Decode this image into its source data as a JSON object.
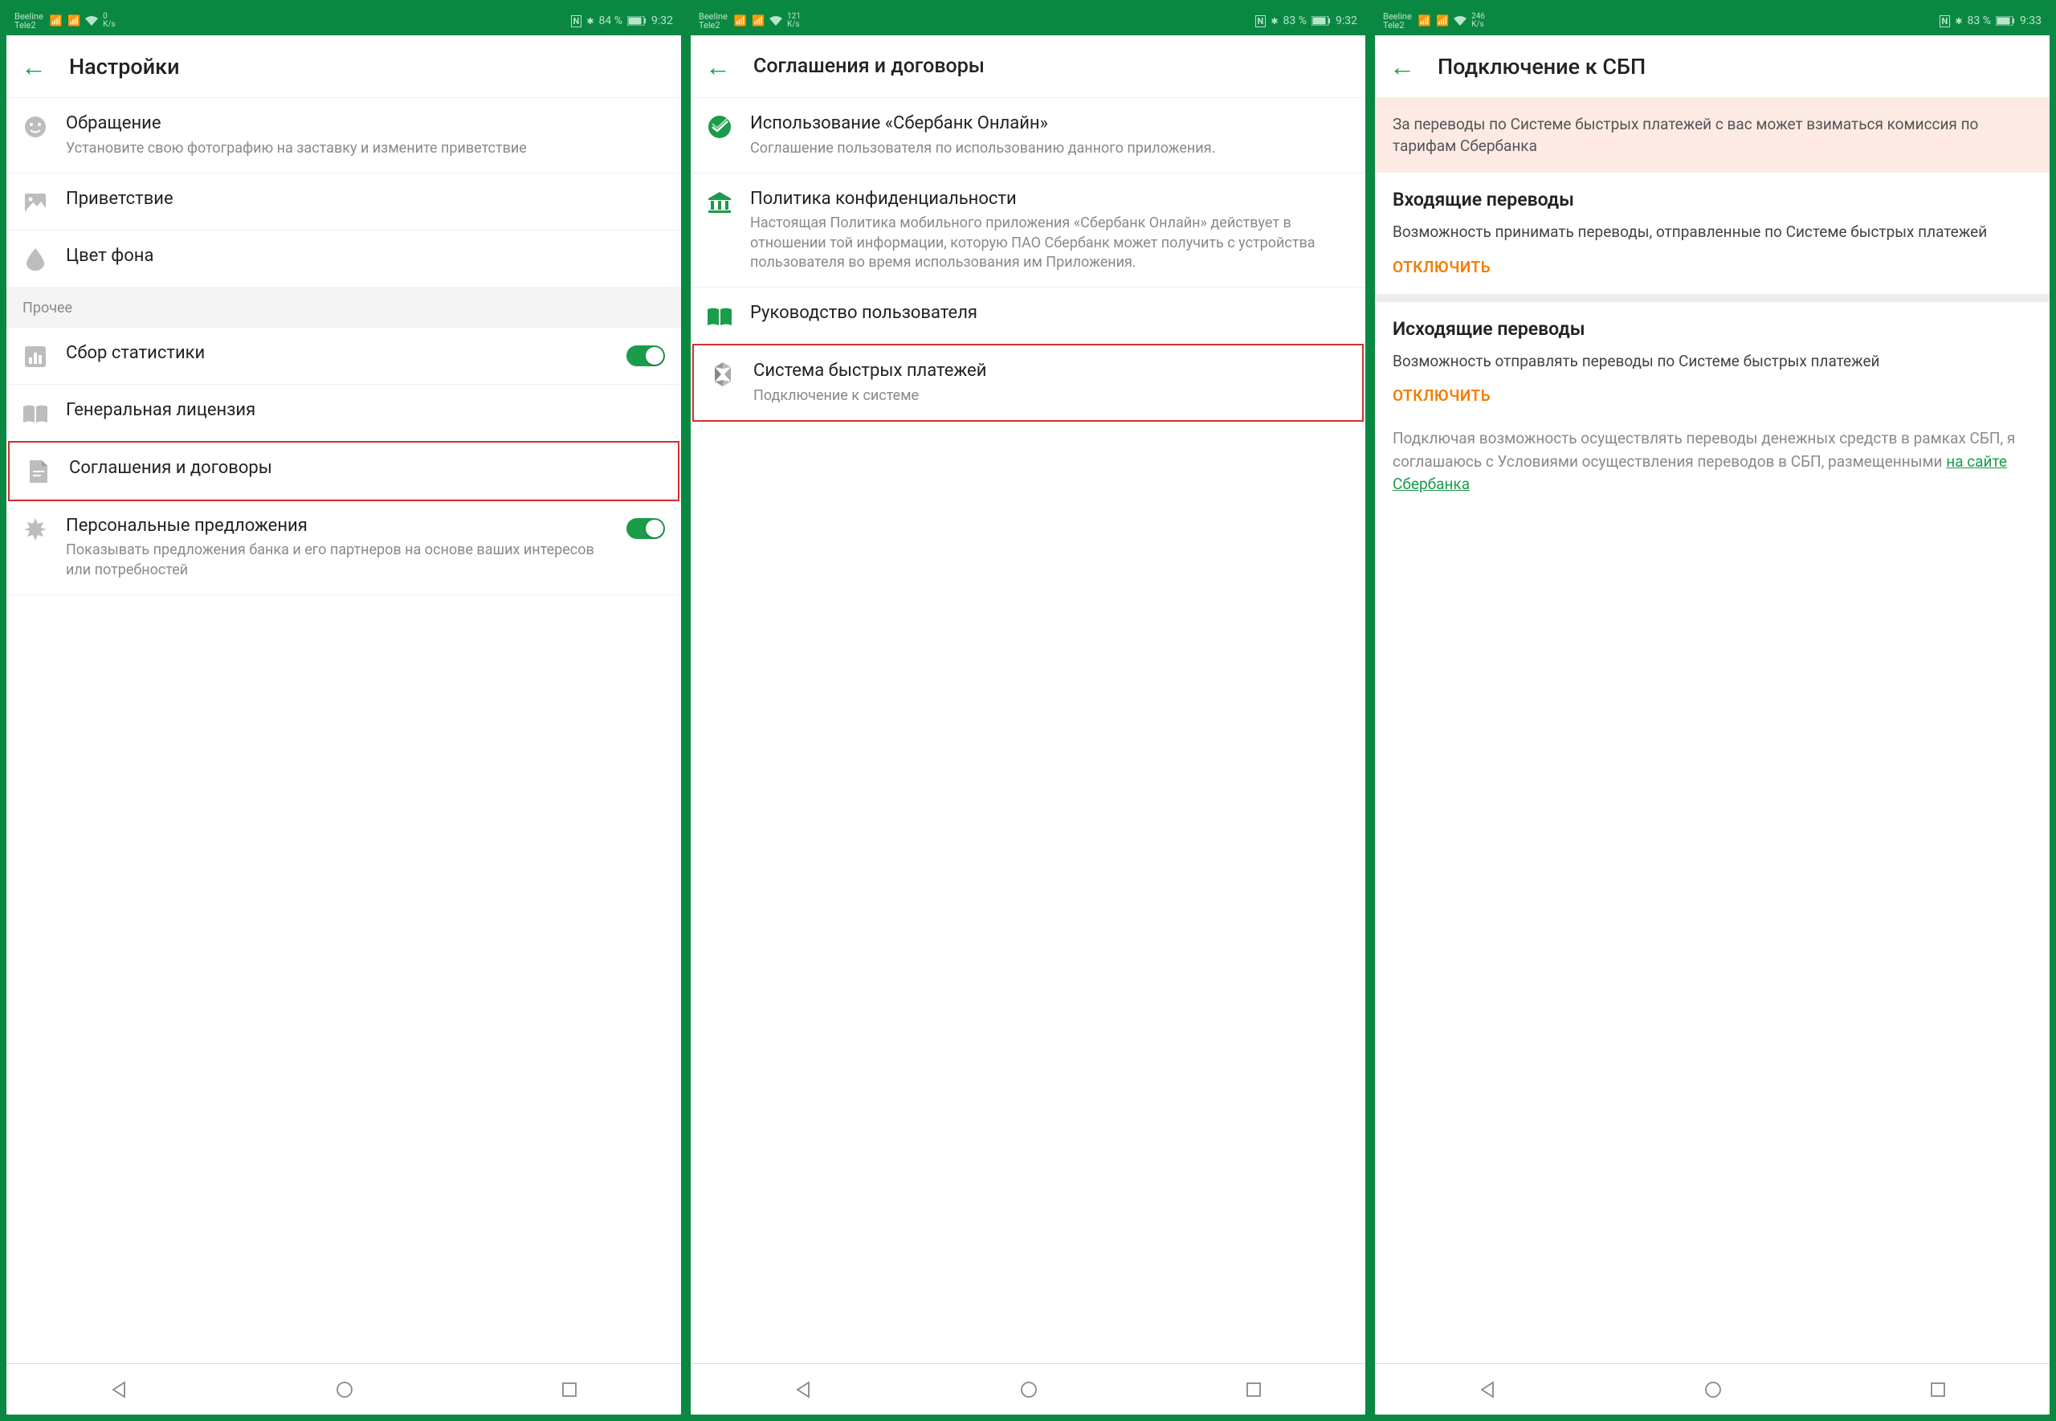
{
  "statusbar": {
    "carrier1": "Beeline",
    "carrier2": "Tele2",
    "speed1_a": "0",
    "speed1_b": "K/s",
    "speed2_a": "121",
    "speed2_b": "K/s",
    "speed3_a": "246",
    "speed3_b": "K/s",
    "nfc": "N",
    "bt": "✱",
    "battery1": "84 %",
    "battery2": "83 %",
    "battery3": "83 %",
    "time1": "9:32",
    "time2": "9:32",
    "time3": "9:33"
  },
  "screen1": {
    "title": "Настройки",
    "items": {
      "greeting": {
        "title": "Обращение",
        "sub": "Установите свою фотографию на заставку и измените приветствие"
      },
      "welcome": {
        "title": "Приветствие"
      },
      "bgcolor": {
        "title": "Цвет фона"
      }
    },
    "section_other": "Прочее",
    "other": {
      "stats": {
        "title": "Сбор статистики"
      },
      "license": {
        "title": "Генеральная лицензия"
      },
      "agreements": {
        "title": "Соглашения и договоры"
      },
      "offers": {
        "title": "Персональные предложения",
        "sub": "Показывать предложения банка и его партнеров на основе ваших интересов или потребностей"
      }
    }
  },
  "screen2": {
    "title": "Соглашения и договоры",
    "items": {
      "sbol": {
        "title": "Использование «Сбербанк Онлайн»",
        "sub": "Соглашение пользователя по использованию данного приложения."
      },
      "privacy": {
        "title": "Политика конфиденциальности",
        "sub": "Настоящая Политика мобильного приложения «Сбербанк Онлайн» действует в отношении той информации, которую ПАО Сбербанк может получить с устройства пользователя во время использования им Приложения."
      },
      "guide": {
        "title": "Руководство пользователя"
      },
      "sbp": {
        "title": "Система быстрых платежей",
        "sub": "Подключение к системе"
      }
    }
  },
  "screen3": {
    "title": "Подключение к СБП",
    "notice": "За переводы по Системе быстрых платежей с вас может взиматься комиссия по тарифам Сбербанка",
    "incoming": {
      "heading": "Входящие переводы",
      "text": "Возможность принимать переводы, отправленные по Системе быстрых платежей",
      "action": "ОТКЛЮЧИТЬ"
    },
    "outgoing": {
      "heading": "Исходящие переводы",
      "text": "Возможность отправлять переводы по Системе быстрых платежей",
      "action": "ОТКЛЮЧИТЬ"
    },
    "footer_pre": "Подключая возможность осуществлять переводы денежных средств в рамках СБП, я соглашаюсь с Условиями осуществления переводов в СБП, размещенными ",
    "footer_link": "на сайте Сбербанка"
  }
}
